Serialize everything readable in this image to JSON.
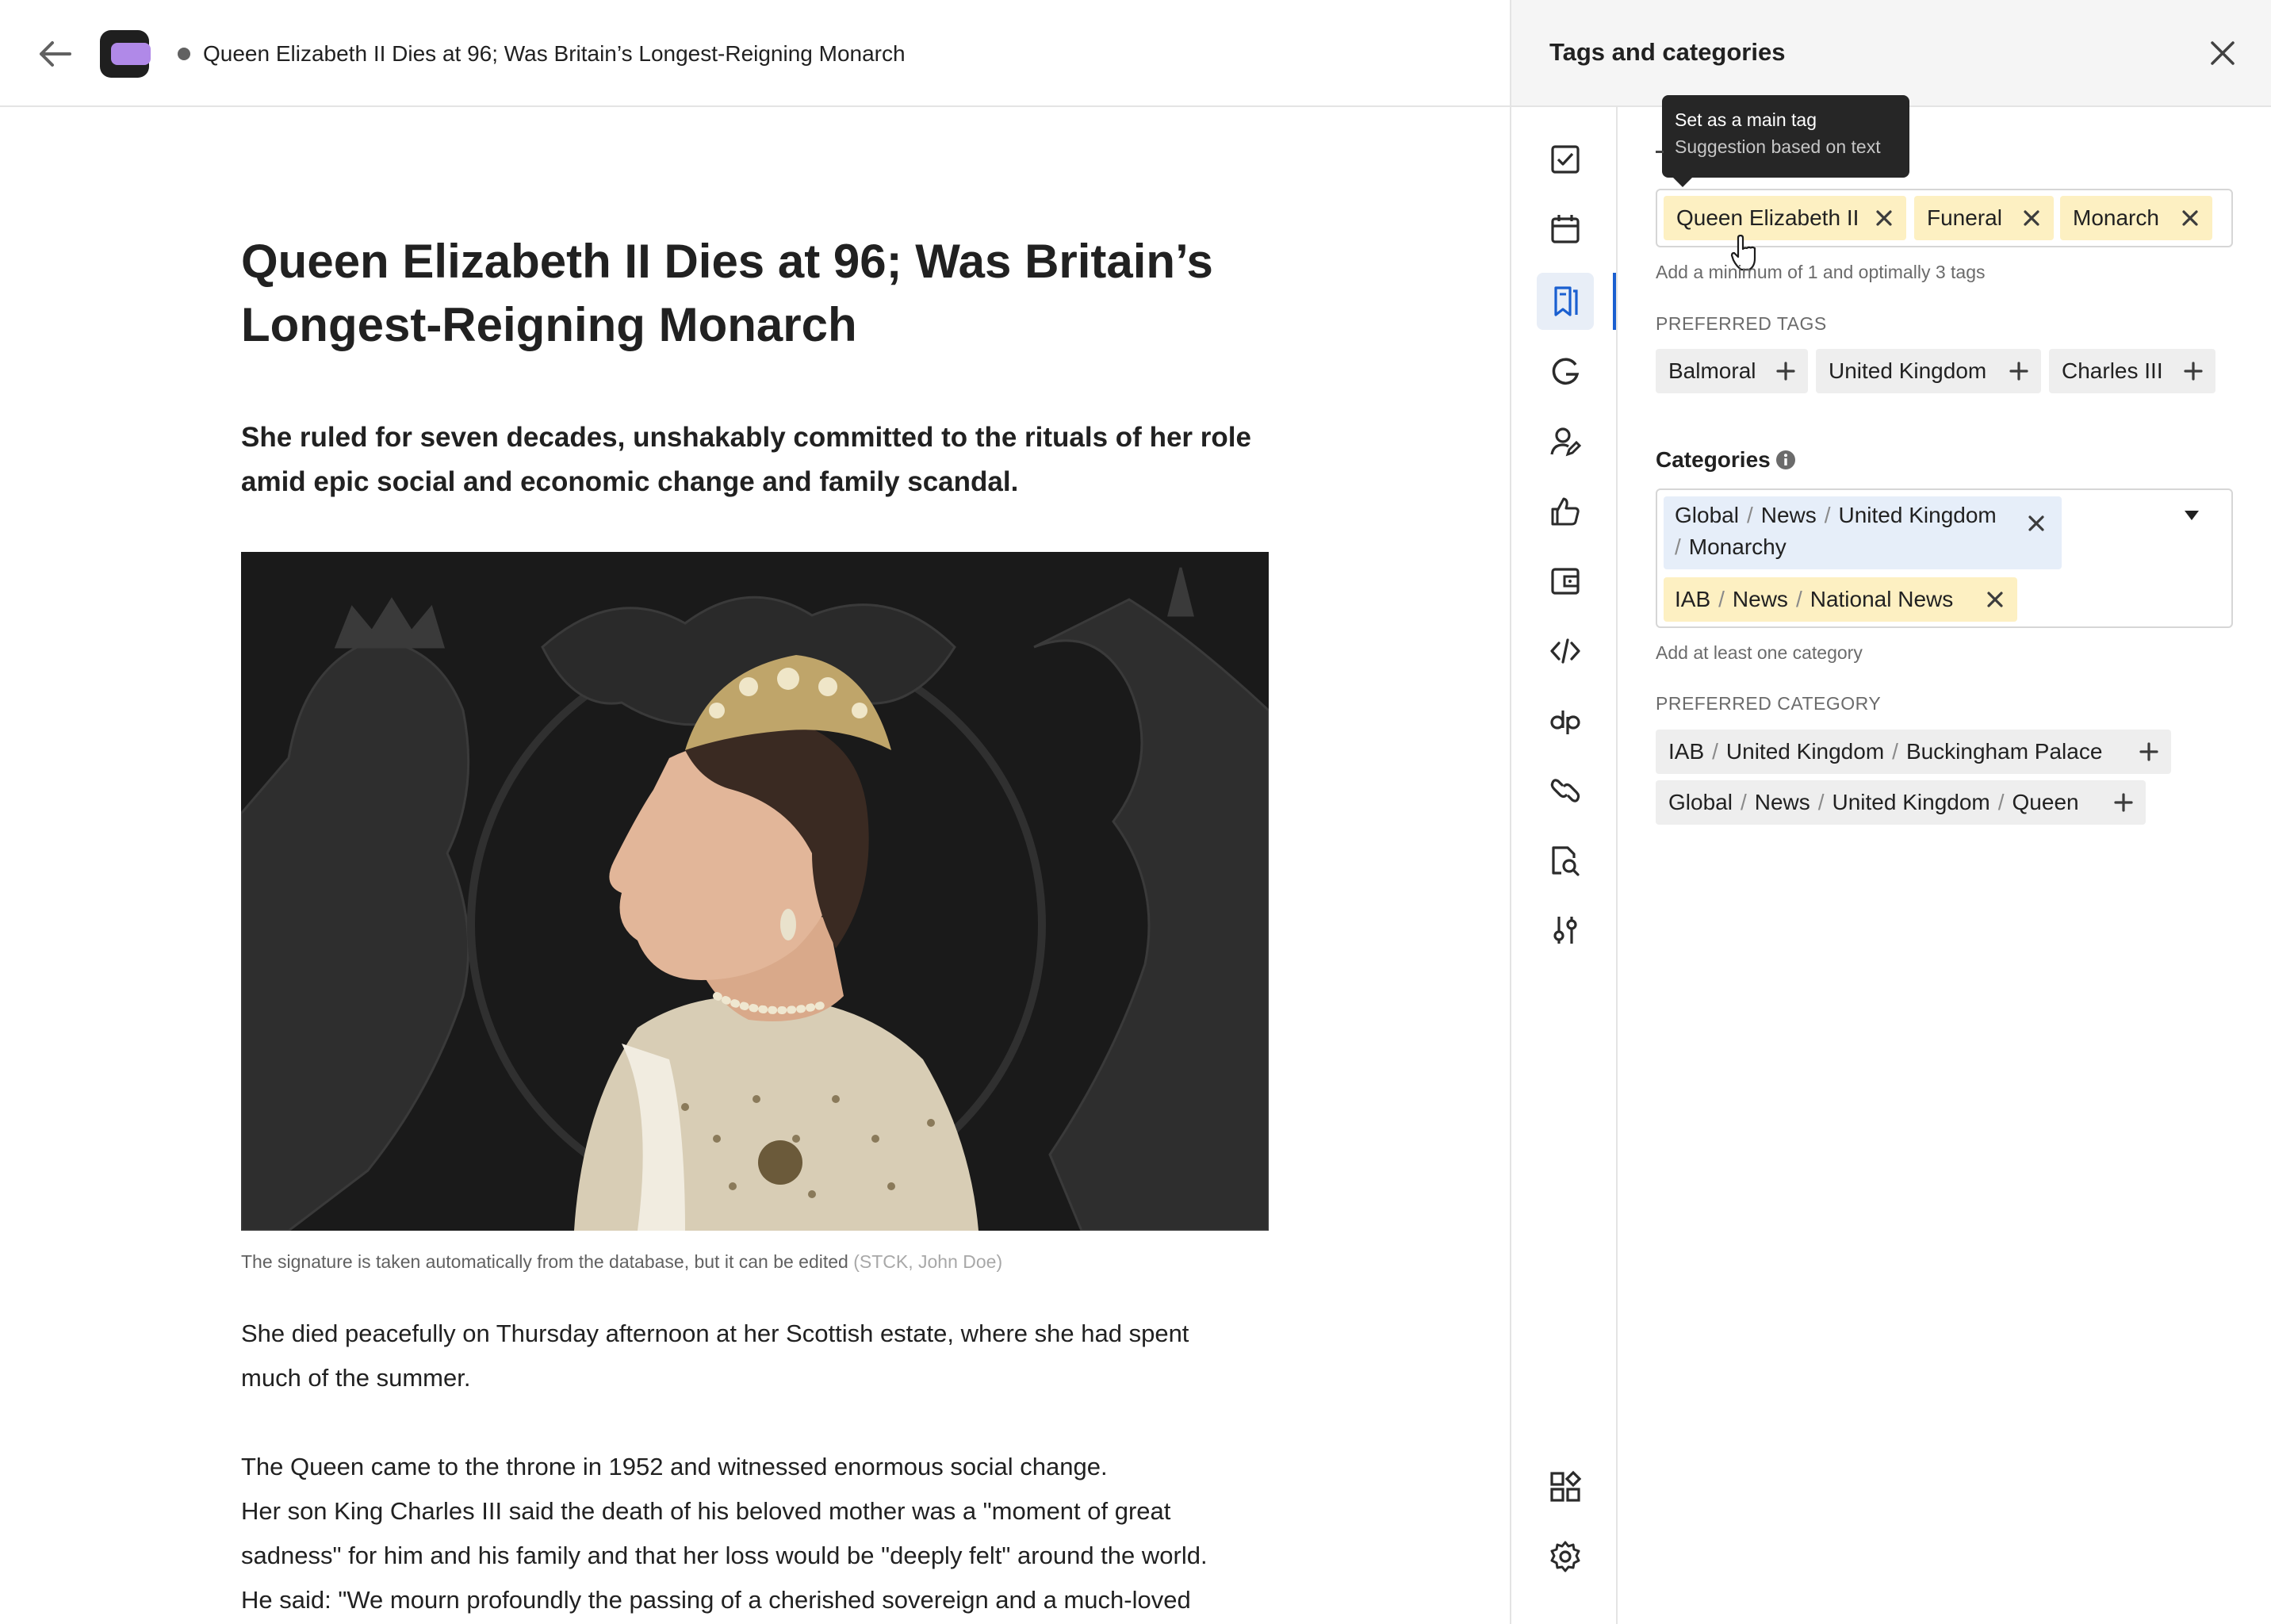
{
  "header": {
    "document_title": "Queen Elizabeth II Dies at 96; Was Britain’s Longest-Reigning Monarch"
  },
  "article": {
    "headline_line1": "Queen Elizabeth II Dies at 96; Was Britain’s",
    "headline_line2": "Longest-Reigning Monarch",
    "lead_line1": "She ruled for seven decades, unshakably committed to the rituals of her role",
    "lead_line2": "amid epic social and economic change and family scandal.",
    "caption": "The signature is taken automatically from the database, but it can be edited",
    "caption_credit": "(STCK, John Doe)",
    "paragraph1_line1": "She died peacefully on Thursday afternoon at her Scottish estate, where she had spent",
    "paragraph1_line2": "much of the summer.",
    "paragraph2_line1": "The Queen came to the throne in 1952 and witnessed enormous social change.",
    "paragraph2_line2": "Her son King Charles III said the death of his beloved mother was a \"moment of great",
    "paragraph2_line3": "sadness\" for him and his family and that her loss would be \"deeply felt\" around the world.",
    "paragraph2_line4": "He said: \"We mourn profoundly the passing of a cherished sovereign and a much-loved"
  },
  "panel": {
    "title": "Tags and categories",
    "tooltip": {
      "title": "Set as a main tag",
      "subtitle": "Suggestion based on text"
    },
    "tags": [
      "Queen Elizabeth II",
      "Funeral",
      "Monarch"
    ],
    "tags_helper": "Add a minimum of 1 and optimally 3 tags",
    "preferred_tags_label": "PREFERRED TAGS",
    "preferred_tags": [
      "Balmoral",
      "United Kingdom",
      "Charles III"
    ],
    "categories_label": "Categories",
    "categories": [
      {
        "path": [
          "Global",
          "News",
          "United Kingdom",
          "Monarchy"
        ],
        "color": "#e6eef9"
      },
      {
        "path": [
          "IAB",
          "News",
          "National News"
        ],
        "color": "#fdf0c2"
      }
    ],
    "categories_helper": "Add at least one category",
    "preferred_category_label": "PREFERRED CATEGORY",
    "preferred_categories": [
      [
        "IAB",
        "United Kingdom",
        "Buckingham Palace"
      ],
      [
        "Global",
        "News",
        "United Kingdom",
        "Queen"
      ]
    ],
    "rail_icons": [
      "checklist-icon",
      "calendar-icon",
      "bookmark-tags-icon",
      "google-icon",
      "author-edit-icon",
      "thumbs-up-icon",
      "wallet-icon",
      "code-icon",
      "dp-icon",
      "link-icon",
      "document-search-icon",
      "sliders-icon",
      "widgets-icon",
      "settings-icon"
    ],
    "active_icon": "bookmark-tags-icon"
  },
  "colors": {
    "tag_chip": "#fdf0c2",
    "category_chip_blue": "#e6eef9",
    "preferred_chip": "#eeeeee",
    "accent": "#1a5fd0",
    "logo_purple": "#b089e8"
  }
}
